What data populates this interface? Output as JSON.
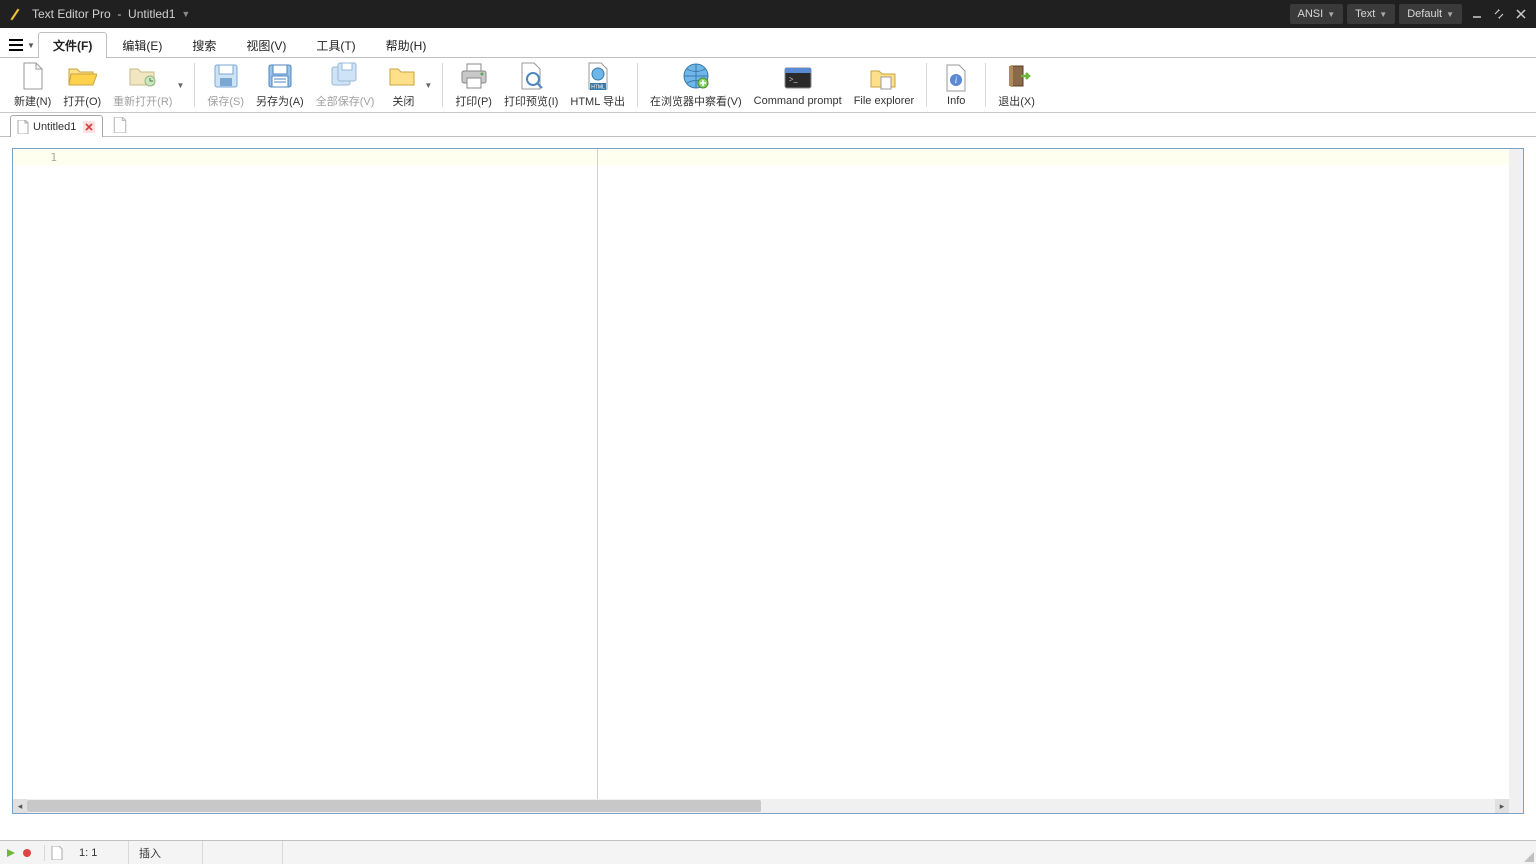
{
  "titlebar": {
    "app_name": "Text Editor Pro",
    "separator": "-",
    "doc_name": "Untitled1",
    "encoding_btn": "ANSI",
    "type_btn": "Text",
    "theme_btn": "Default"
  },
  "ribbon": {
    "tabs": [
      {
        "label": "文件(F)",
        "active": true
      },
      {
        "label": "编辑(E)",
        "active": false
      },
      {
        "label": "搜索",
        "active": false
      },
      {
        "label": "视图(V)",
        "active": false
      },
      {
        "label": "工具(T)",
        "active": false
      },
      {
        "label": "帮助(H)",
        "active": false
      }
    ]
  },
  "toolbar": {
    "new": "新建(N)",
    "open": "打开(O)",
    "reopen": "重新打开(R)",
    "save": "保存(S)",
    "saveas": "另存为(A)",
    "saveall": "全部保存(V)",
    "close": "关闭",
    "print": "打印(P)",
    "printprev": "打印预览(I)",
    "htmlexp": "HTML 导出",
    "browser": "在浏览器中察看(V)",
    "cmd": "Command prompt",
    "fileexp": "File explorer",
    "info": "Info",
    "exit": "退出(X)"
  },
  "doctab": {
    "name": "Untitled1"
  },
  "editor": {
    "line1": "1"
  },
  "status": {
    "position": "1: 1",
    "mode": "插入"
  }
}
